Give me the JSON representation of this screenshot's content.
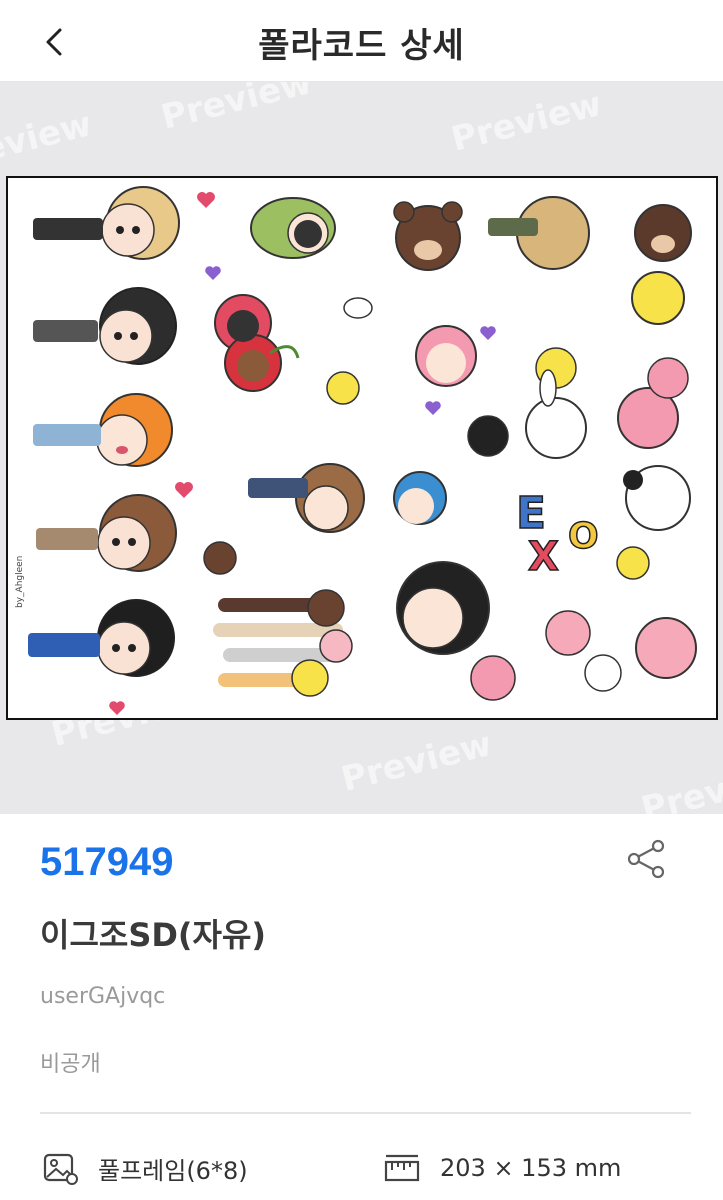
{
  "header": {
    "title": "폴라코드 상세",
    "back_icon": "chevron-left-icon"
  },
  "preview": {
    "watermark": "Preview",
    "sheet_signature": "by_Ahgleen"
  },
  "detail": {
    "code": "517949",
    "name": "이그조SD(자유)",
    "user": "userGAjvqc",
    "privacy": "비공개",
    "share_icon": "share-icon",
    "frame_icon": "image-icon",
    "frame_label": "풀프레임(6*8)",
    "size_icon": "ruler-icon",
    "size_label": "203 × 153 mm",
    "accent_color": "#1a73e8"
  }
}
